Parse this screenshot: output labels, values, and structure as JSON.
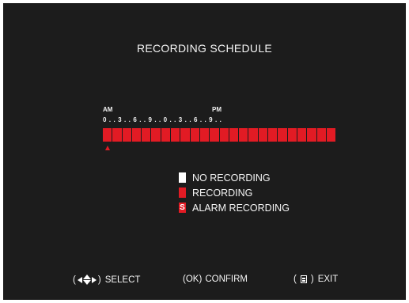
{
  "screen": {
    "title": "RECORDING SCHEDULE"
  },
  "timeline": {
    "am_label": "AM",
    "pm_label": "PM",
    "tick_text": "0 . . 3 . . 6 . . 9 . . 0 . . 3 . . 6 . . 9 . .",
    "hour_states": [
      "recording",
      "recording",
      "recording",
      "recording",
      "recording",
      "recording",
      "recording",
      "recording",
      "recording",
      "recording",
      "recording",
      "recording",
      "recording",
      "recording",
      "recording",
      "recording",
      "recording",
      "recording",
      "recording",
      "recording",
      "recording",
      "recording",
      "recording",
      "recording"
    ],
    "cursor_hour": 0
  },
  "legend": {
    "items": [
      {
        "label": "NO RECORDING",
        "color": "#ffffff",
        "symbol": ""
      },
      {
        "label": "RECORDING",
        "color": "#e21b24",
        "symbol": ""
      },
      {
        "label": "ALARM RECORDING",
        "color": "#e21b24",
        "symbol": "S"
      }
    ]
  },
  "footer": {
    "select_label": "SELECT",
    "confirm_key": "OK",
    "confirm_label": "CONFIRM",
    "exit_label": "EXIT"
  },
  "colors": {
    "background": "#1c1c1c",
    "recording": "#e21b24",
    "text": "#f4f4f4"
  },
  "icons": [
    "left-arrow-icon",
    "up-down-arrow-icon",
    "right-arrow-icon",
    "menu-icon"
  ]
}
